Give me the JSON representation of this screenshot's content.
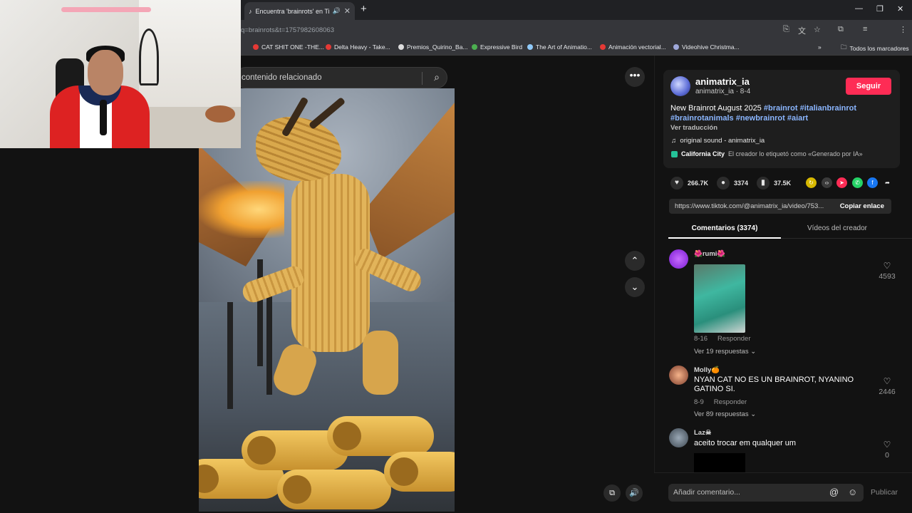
{
  "browser": {
    "tab_title": "Encuentra 'brainrots' en Tik",
    "url": "q=brainrots&t=1757982608063",
    "bookmarks": [
      "CAT SHIT ONE -THE...",
      "Delta Heavy - Take...",
      "Premios_Quirino_Ba...",
      "Expressive Bird",
      "The Art of Animatio...",
      "Animación vectorial...",
      "Videohive Christma..."
    ],
    "all_bookmarks": "Todos los marcadores"
  },
  "search": {
    "placeholder": "contenido relacionado"
  },
  "creator": {
    "name": "animatrix_ia",
    "sub": "animatrix_ia · 8-4",
    "follow_label": "Seguir",
    "desc_plain": "New Brainrot August 2025 ",
    "tags": [
      "#brainrot",
      "#italianbrainrot",
      "#brainrotanimals",
      "#newbrainrot",
      "#aiart"
    ],
    "translate": "Ver traducción",
    "sound": "original sound - animatrix_ia",
    "location": "California City",
    "ai_label": "El creador lo etiquetó como «Generado por IA»"
  },
  "stats": {
    "likes": "266.7K",
    "comments": "3374",
    "saves": "37.5K"
  },
  "share": {
    "link": "https://www.tiktok.com/@animatrix_ia/video/753...",
    "copy_label": "Copiar enlace"
  },
  "tabs": {
    "comments": "Comentarios (3374)",
    "videos": "Vídeos del creador"
  },
  "comments": [
    {
      "name": "🌺rumi🌺",
      "text": "",
      "date": "8-16",
      "reply": "Responder",
      "more": "Ver 19 respuestas",
      "likes": "4593"
    },
    {
      "name": "Molly🍊",
      "text": "NYAN CAT NO ES UN BRAINROT, NYANINO GATINO SI.",
      "date": "8-9",
      "reply": "Responder",
      "more": "Ver 89 respuestas",
      "likes": "2446"
    },
    {
      "name": "Laz☠",
      "text": "aceito trocar em qualquer um",
      "likes": "0"
    }
  ],
  "footer": {
    "placeholder": "Añadir comentario...",
    "publish": "Publicar"
  },
  "colors": {
    "accent": "#fe2c55",
    "tag": "#8bb6ff"
  }
}
